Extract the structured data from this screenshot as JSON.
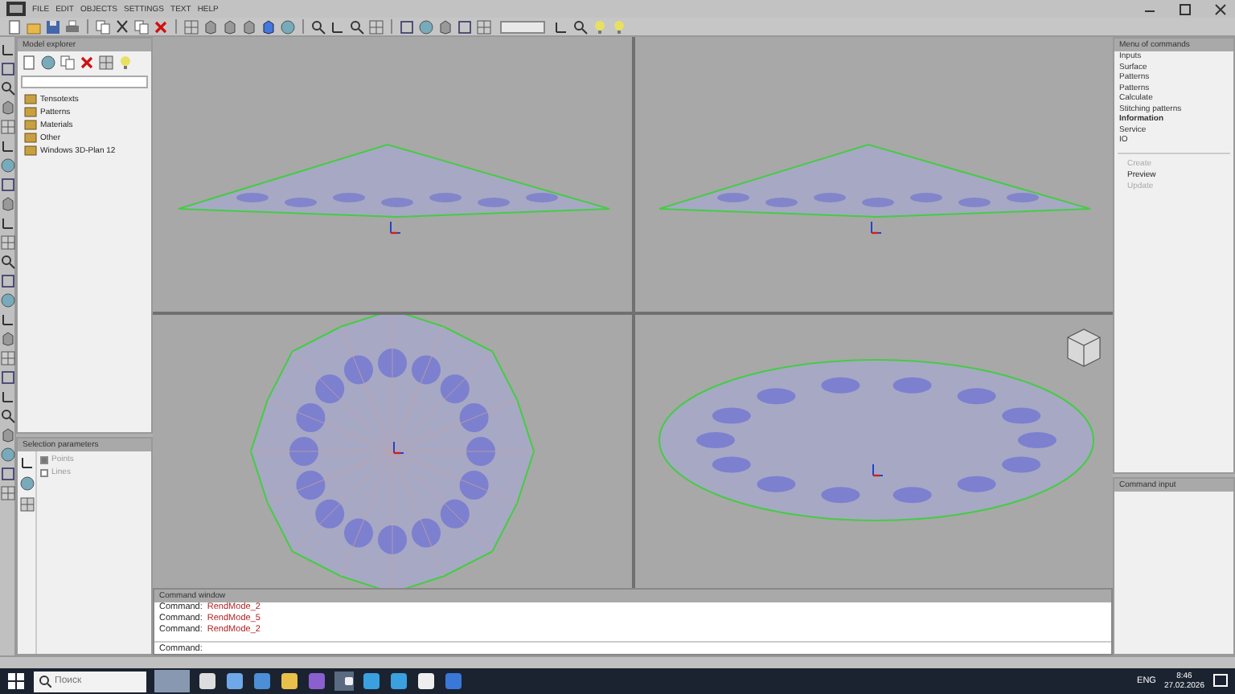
{
  "menu": [
    "FILE",
    "EDIT",
    "OBJECTS",
    "SETTINGS",
    "TEXT",
    "HELP"
  ],
  "explorer": {
    "title": "Model explorer",
    "items": [
      {
        "label": "Tensotexts"
      },
      {
        "label": "Patterns"
      },
      {
        "label": "Materials"
      },
      {
        "label": "Other"
      },
      {
        "label": "Windows 3D-Plan 12"
      }
    ]
  },
  "selection_panel": {
    "title": "Selection parameters",
    "options": [
      {
        "label": "Points",
        "checked": true
      },
      {
        "label": "Lines",
        "checked": false
      }
    ]
  },
  "commands_panel": {
    "title": "Menu of commands",
    "items": [
      {
        "label": "Inputs",
        "selected": false
      },
      {
        "label": "Surface",
        "selected": false
      },
      {
        "label": "Patterns",
        "selected": false
      },
      {
        "label": "Patterns",
        "selected": false
      },
      {
        "label": "Calculate",
        "selected": false
      },
      {
        "label": "Stitching patterns",
        "selected": false
      },
      {
        "label": "Information",
        "selected": true
      },
      {
        "label": "Service",
        "selected": false
      },
      {
        "label": "IO",
        "selected": false
      }
    ],
    "actions": [
      {
        "label": "Create",
        "disabled": true
      },
      {
        "label": "Preview",
        "disabled": false
      },
      {
        "label": "Update",
        "disabled": true
      }
    ]
  },
  "input_panel": {
    "title": "Command input"
  },
  "command_window": {
    "title": "Command window",
    "lines": [
      {
        "prefix": "Command:",
        "command": "RendMode_2"
      },
      {
        "prefix": "Command:",
        "command": "RendMode_5"
      },
      {
        "prefix": "Command:",
        "command": "RendMode_2"
      }
    ],
    "prompt": "Command:"
  },
  "taskbar": {
    "search_placeholder": "Поиск",
    "language": "ENG",
    "time": "8:46",
    "date": "27.02.2026"
  }
}
